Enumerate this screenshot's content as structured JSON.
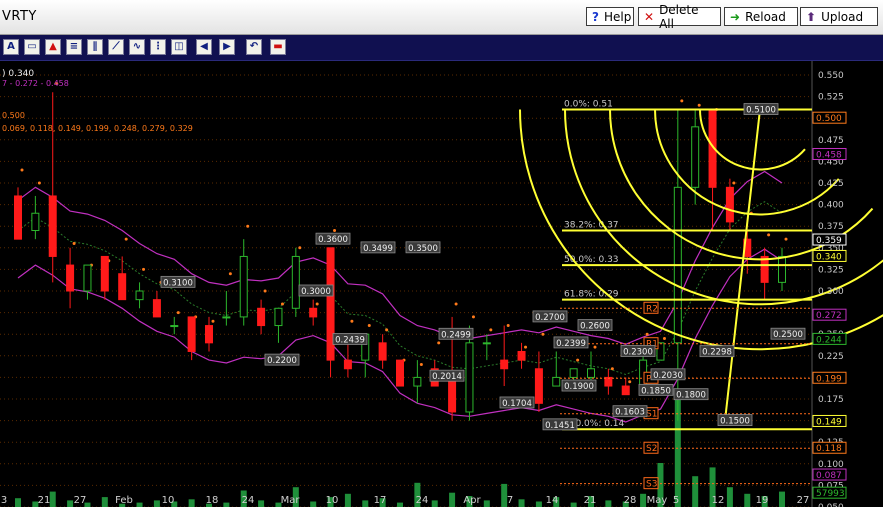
{
  "header": {
    "ticker": "VRTY",
    "buttons": {
      "help": "Help",
      "delete_all": "Delete All",
      "reload": "Reload",
      "upload": "Upload"
    }
  },
  "toolbar": {
    "tools": [
      "text-tool-icon",
      "comment-tool-icon",
      "arrow-up-tool-icon",
      "horizontal-lines-tool-icon",
      "vertical-lines-tool-icon",
      "trend-fan-tool-icon",
      "wave-tool-icon",
      "cycle-tool-icon",
      "shift-left-tool-icon",
      "shift-right-tool-icon",
      "undo-tool-icon",
      "color-tool-icon"
    ]
  },
  "legend": {
    "line1": ") 0.340",
    "line2": "7 - 0.272 - 0.458",
    "line3": "0.500",
    "line4": "0.069, 0.118, 0.149, 0.199, 0.248, 0.279, 0.329"
  },
  "colors": {
    "background": "#000000",
    "up_candle": "#2db82d",
    "down_candle": "#ff1a1a",
    "bollinger": "#c030c0",
    "fib_lines": "#ffff33",
    "sar_dots": "#ff7a1a",
    "volume": "#1f8f3a",
    "axis_text": "#c8c8c8",
    "pivot_label": "#ff6a1a"
  },
  "chart_data": {
    "type": "candlestick",
    "price_axis": {
      "ylim": [
        0.05,
        0.55
      ],
      "ticks": [
        "0.550",
        "0.525",
        "0.500",
        "0.475",
        "0.450",
        "0.425",
        "0.400",
        "0.375",
        "0.350",
        "0.325",
        "0.300",
        "0.275",
        "0.250",
        "0.225",
        "0.200",
        "0.175",
        "0.150",
        "0.125",
        "0.100",
        "0.075",
        "0.050"
      ]
    },
    "x_axis_labels": [
      "3",
      "21",
      "27",
      "Feb",
      "10",
      "18",
      "24",
      "Mar",
      "10",
      "17",
      "24",
      "Apr",
      "7",
      "14",
      "21",
      "28",
      "May",
      "5",
      "12",
      "19",
      "27"
    ],
    "price_axis_markers": [
      {
        "label": "0.500",
        "value": 0.5,
        "color": "#ff7a1a"
      },
      {
        "label": "0.458",
        "value": 0.458,
        "color": "#c030c0"
      },
      {
        "label": "0.359",
        "value": 0.359,
        "color": "#ffffff"
      },
      {
        "label": "0.340",
        "value": 0.34,
        "color": "#ffff33"
      },
      {
        "label": "0.272",
        "value": 0.272,
        "color": "#c030c0"
      },
      {
        "label": "0.244",
        "value": 0.244,
        "color": "#2db82d"
      },
      {
        "label": "0.199",
        "value": 0.199,
        "color": "#ff7a1a"
      },
      {
        "label": "0.149",
        "value": 0.149,
        "color": "#ffff33"
      },
      {
        "label": "0.118",
        "value": 0.118,
        "color": "#ff7a1a"
      },
      {
        "label": "0.087",
        "value": 0.087,
        "color": "#c030c0"
      },
      {
        "label": "57993",
        "value": 0.066,
        "color": "#2db82d"
      }
    ],
    "fibonacci": [
      {
        "label": "0.0%: 0.51",
        "value": 0.51
      },
      {
        "label": "38.2%: 0.37",
        "value": 0.37
      },
      {
        "label": "50.0%: 0.33",
        "value": 0.33
      },
      {
        "label": "61.8%: 0.29",
        "value": 0.29
      },
      {
        "label": "100.0%: 0.14",
        "value": 0.14
      }
    ],
    "pivots": [
      {
        "label": "R2",
        "value": 0.28
      },
      {
        "label": "R1",
        "value": 0.239
      },
      {
        "label": "P",
        "value": 0.199
      },
      {
        "label": "S1",
        "value": 0.158
      },
      {
        "label": "S2",
        "value": 0.118
      },
      {
        "label": "S3",
        "value": 0.077
      }
    ],
    "price_labels": [
      {
        "text": "0.3600",
        "value": 0.36
      },
      {
        "text": "0.3499",
        "value": 0.3499
      },
      {
        "text": "0.3500",
        "value": 0.35
      },
      {
        "text": "0.3100",
        "value": 0.31
      },
      {
        "text": "0.3000",
        "value": 0.3
      },
      {
        "text": "0.2700",
        "value": 0.27
      },
      {
        "text": "0.2600",
        "value": 0.26
      },
      {
        "text": "0.2499",
        "value": 0.2499
      },
      {
        "text": "0.2439",
        "value": 0.2439
      },
      {
        "text": "0.2399",
        "value": 0.2399
      },
      {
        "text": "0.2300",
        "value": 0.23
      },
      {
        "text": "0.2298",
        "value": 0.2298
      },
      {
        "text": "0.2500",
        "value": 0.25
      },
      {
        "text": "0.2200",
        "value": 0.22
      },
      {
        "text": "0.2030",
        "value": 0.203
      },
      {
        "text": "0.2014",
        "value": 0.2014
      },
      {
        "text": "0.1900",
        "value": 0.19
      },
      {
        "text": "0.1850",
        "value": 0.185
      },
      {
        "text": "0.1800",
        "value": 0.18
      },
      {
        "text": "0.1704",
        "value": 0.1704
      },
      {
        "text": "0.1603",
        "value": 0.1603
      },
      {
        "text": "0.1500",
        "value": 0.15
      },
      {
        "text": "0.1451",
        "value": 0.1451
      },
      {
        "text": "0.5100",
        "value": 0.51
      }
    ],
    "candles": [
      [
        0.41,
        0.42,
        0.37,
        0.36
      ],
      [
        0.37,
        0.41,
        0.36,
        0.39
      ],
      [
        0.41,
        0.53,
        0.31,
        0.34
      ],
      [
        0.33,
        0.35,
        0.28,
        0.3
      ],
      [
        0.3,
        0.33,
        0.29,
        0.33
      ],
      [
        0.34,
        0.34,
        0.29,
        0.3
      ],
      [
        0.32,
        0.34,
        0.29,
        0.29
      ],
      [
        0.29,
        0.31,
        0.28,
        0.3
      ],
      [
        0.29,
        0.3,
        0.27,
        0.27
      ],
      [
        0.26,
        0.27,
        0.25,
        0.26
      ],
      [
        0.27,
        0.27,
        0.22,
        0.23
      ],
      [
        0.26,
        0.27,
        0.23,
        0.24
      ],
      [
        0.27,
        0.3,
        0.26,
        0.27
      ],
      [
        0.27,
        0.36,
        0.26,
        0.34
      ],
      [
        0.28,
        0.29,
        0.25,
        0.26
      ],
      [
        0.26,
        0.28,
        0.24,
        0.28
      ],
      [
        0.28,
        0.35,
        0.27,
        0.34
      ],
      [
        0.28,
        0.29,
        0.26,
        0.27
      ],
      [
        0.35,
        0.35,
        0.2,
        0.22
      ],
      [
        0.22,
        0.25,
        0.2,
        0.21
      ],
      [
        0.22,
        0.25,
        0.2,
        0.25
      ],
      [
        0.24,
        0.25,
        0.21,
        0.22
      ],
      [
        0.22,
        0.22,
        0.19,
        0.19
      ],
      [
        0.19,
        0.22,
        0.17,
        0.2
      ],
      [
        0.21,
        0.22,
        0.19,
        0.19
      ],
      [
        0.2,
        0.27,
        0.15,
        0.16
      ],
      [
        0.16,
        0.26,
        0.15,
        0.24
      ],
      [
        0.24,
        0.25,
        0.22,
        0.24
      ],
      [
        0.22,
        0.26,
        0.19,
        0.21
      ],
      [
        0.23,
        0.24,
        0.21,
        0.22
      ],
      [
        0.21,
        0.23,
        0.16,
        0.17
      ],
      [
        0.19,
        0.23,
        0.19,
        0.2
      ],
      [
        0.2,
        0.21,
        0.19,
        0.21
      ],
      [
        0.2,
        0.23,
        0.19,
        0.21
      ],
      [
        0.2,
        0.21,
        0.18,
        0.19
      ],
      [
        0.19,
        0.2,
        0.18,
        0.18
      ],
      [
        0.19,
        0.23,
        0.18,
        0.22
      ],
      [
        0.22,
        0.23,
        0.22,
        0.24
      ],
      [
        0.24,
        0.51,
        0.15,
        0.42
      ],
      [
        0.42,
        0.51,
        0.4,
        0.49
      ],
      [
        0.51,
        0.51,
        0.37,
        0.42
      ],
      [
        0.42,
        0.43,
        0.37,
        0.38
      ],
      [
        0.36,
        0.37,
        0.32,
        0.34
      ],
      [
        0.34,
        0.35,
        0.29,
        0.31
      ],
      [
        0.31,
        0.35,
        0.3,
        0.34
      ]
    ],
    "volume": [
      8,
      5,
      14,
      6,
      4,
      9,
      3,
      4,
      6,
      5,
      7,
      3,
      4,
      15,
      6,
      4,
      18,
      5,
      9,
      12,
      6,
      8,
      4,
      22,
      6,
      13,
      10,
      6,
      21,
      7,
      5,
      9,
      4,
      10,
      6,
      5,
      12,
      40,
      100,
      28,
      36,
      18,
      12,
      10,
      14
    ]
  }
}
